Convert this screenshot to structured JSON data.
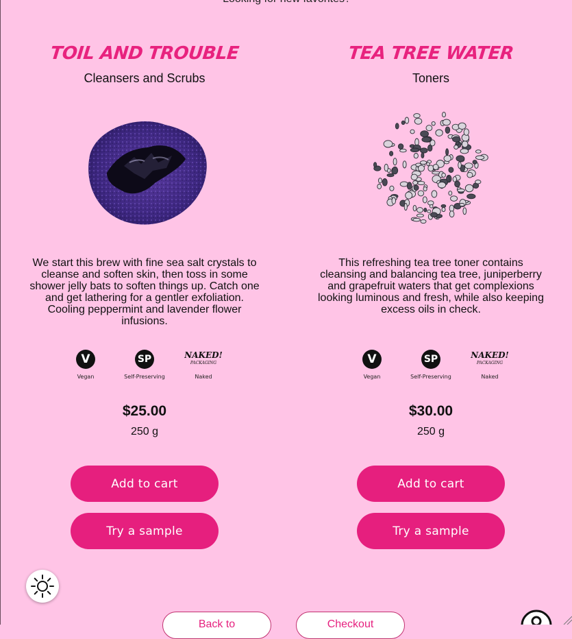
{
  "top_text": "Looking for new favorites?",
  "products": [
    {
      "name": "Toil and Trouble",
      "category": "Cleansers and Scrubs",
      "description": "We start this brew with fine sea salt crystals to cleanse and soften skin, then toss in some shower jelly bats to soften things up. Catch one and get lathering for a gentler exfoliation. Cooling peppermint and lavender flower infusions.",
      "badges": [
        {
          "symbol": "V",
          "label": "Vegan",
          "icon": "vegan-icon"
        },
        {
          "symbol": "SP",
          "label": "Self-Preserving",
          "icon": "self-preserving-icon"
        },
        {
          "symbol": "NAKED!",
          "label": "Naked",
          "icon": "naked-packaging-icon"
        }
      ],
      "price": "$25.00",
      "size": "250 g",
      "add_to_cart_label": "Add to cart",
      "sample_label": "Try a sample"
    },
    {
      "name": "Tea Tree Water",
      "category": "Toners",
      "description": "This refreshing tea tree toner contains cleansing and balancing tea tree, juniperberry and grapefruit waters that get complexions looking luminous and fresh, while also keeping excess oils in check.",
      "badges": [
        {
          "symbol": "V",
          "label": "Vegan",
          "icon": "vegan-icon"
        },
        {
          "symbol": "SP",
          "label": "Self-Preserving",
          "icon": "self-preserving-icon"
        },
        {
          "symbol": "NAKED!",
          "label": "Naked",
          "icon": "naked-packaging-icon"
        }
      ],
      "price": "$30.00",
      "size": "250 g",
      "add_to_cart_label": "Add to cart",
      "sample_label": "Try a sample"
    }
  ],
  "naked_sub": "PACKAGING",
  "footer": {
    "back_label": "Back to",
    "checkout_label": "Checkout"
  },
  "colors": {
    "background": "#ffc4e6",
    "accent": "#e61f7e"
  }
}
